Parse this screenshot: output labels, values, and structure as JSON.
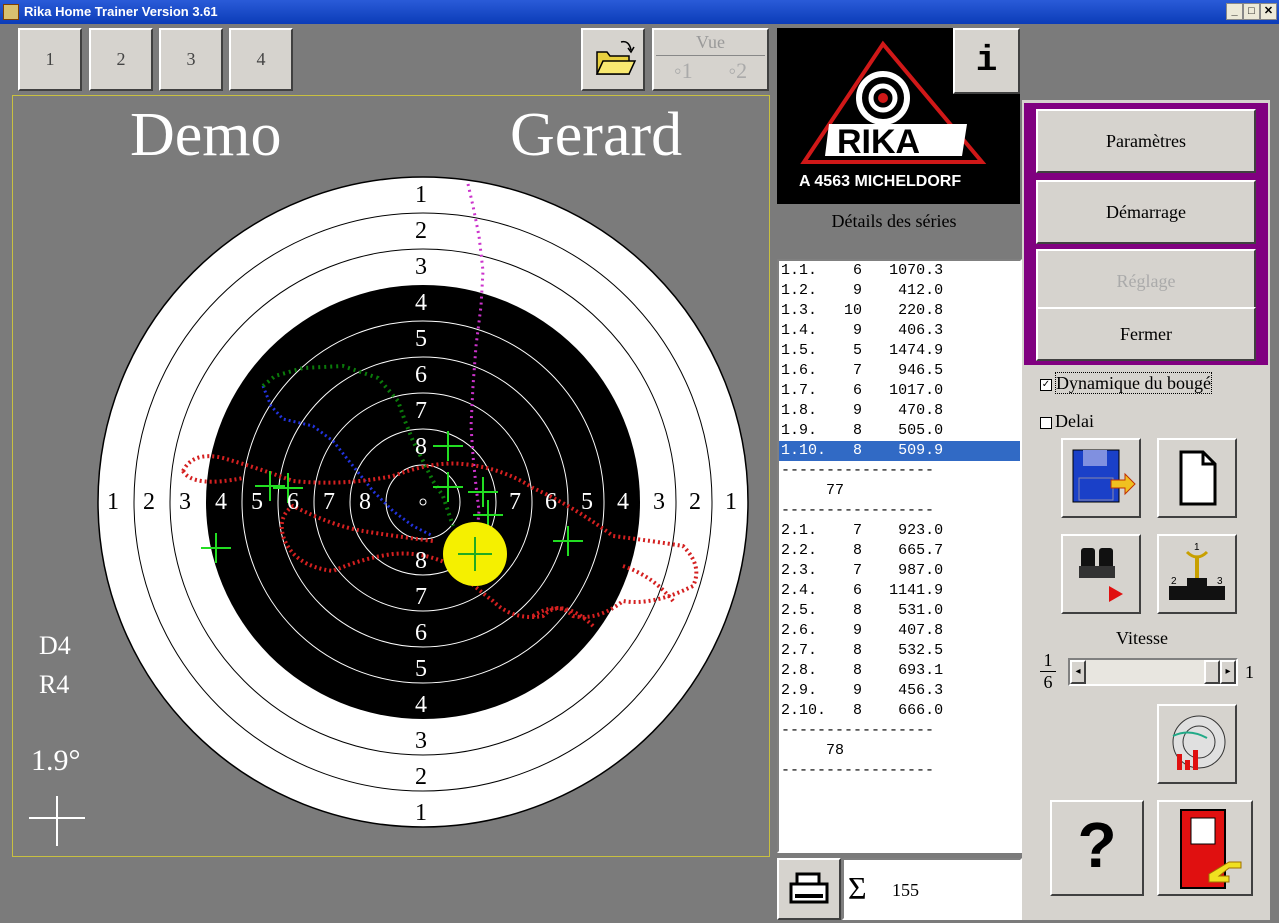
{
  "window": {
    "title": "Rika Home Trainer Version 3.61"
  },
  "top_buttons": [
    "1",
    "2",
    "3",
    "4"
  ],
  "vue": {
    "label": "Vue",
    "option1": "1",
    "option2": "2"
  },
  "names": {
    "left": "Demo",
    "right": "Gerard"
  },
  "target": {
    "vertical_labels_top": [
      "1",
      "2",
      "3",
      "4",
      "5",
      "6",
      "7",
      "8"
    ],
    "vertical_labels_bottom": [
      "8",
      "7",
      "6",
      "5",
      "4",
      "3",
      "2",
      "1"
    ],
    "horizontal_labels_left": [
      "1",
      "2",
      "3",
      "4",
      "5",
      "6",
      "7",
      "8"
    ],
    "horizontal_labels_right": [
      "7",
      "6",
      "5",
      "4",
      "3",
      "2",
      "1"
    ]
  },
  "side_info": {
    "d": "D4",
    "r": "R4",
    "angle": "1.9°"
  },
  "logo": {
    "brand": "RIKA",
    "address": "A 4563 MICHELDORF"
  },
  "info_button": "i",
  "details_title": "Détails des séries",
  "series_rows": [
    {
      "id": "1.1.",
      "score": "6",
      "time": "1070.3"
    },
    {
      "id": "1.2.",
      "score": "9",
      "time": "412.0"
    },
    {
      "id": "1.3.",
      "score": "10",
      "time": "220.8"
    },
    {
      "id": "1.4.",
      "score": "9",
      "time": "406.3"
    },
    {
      "id": "1.5.",
      "score": "5",
      "time": "1474.9"
    },
    {
      "id": "1.6.",
      "score": "7",
      "time": "946.5"
    },
    {
      "id": "1.7.",
      "score": "6",
      "time": "1017.0"
    },
    {
      "id": "1.8.",
      "score": "9",
      "time": "470.8"
    },
    {
      "id": "1.9.",
      "score": "8",
      "time": "505.0"
    },
    {
      "id": "1.10.",
      "score": "8",
      "time": "509.9"
    }
  ],
  "series1_total": "77",
  "series2_rows": [
    {
      "id": "2.1.",
      "score": "7",
      "time": "923.0"
    },
    {
      "id": "2.2.",
      "score": "8",
      "time": "665.7"
    },
    {
      "id": "2.3.",
      "score": "7",
      "time": "987.0"
    },
    {
      "id": "2.4.",
      "score": "6",
      "time": "1141.9"
    },
    {
      "id": "2.5.",
      "score": "8",
      "time": "531.0"
    },
    {
      "id": "2.6.",
      "score": "9",
      "time": "407.8"
    },
    {
      "id": "2.7.",
      "score": "8",
      "time": "532.5"
    },
    {
      "id": "2.8.",
      "score": "8",
      "time": "693.1"
    },
    {
      "id": "2.9.",
      "score": "9",
      "time": "456.3"
    },
    {
      "id": "2.10.",
      "score": "8",
      "time": "666.0"
    }
  ],
  "series2_total": "78",
  "sum": {
    "symbol": "Σ",
    "value": "155"
  },
  "menu": {
    "parametres": "Paramètres",
    "demarrage": "Démarrage",
    "reglage": "Réglage",
    "fermer": "Fermer"
  },
  "options": {
    "dynamique": "Dynamique du bougé",
    "delai": "Delai"
  },
  "vitesse": {
    "label": "Vitesse",
    "frac_num": "1",
    "frac_den": "6",
    "max": "1"
  },
  "icons": {
    "help": "?"
  }
}
